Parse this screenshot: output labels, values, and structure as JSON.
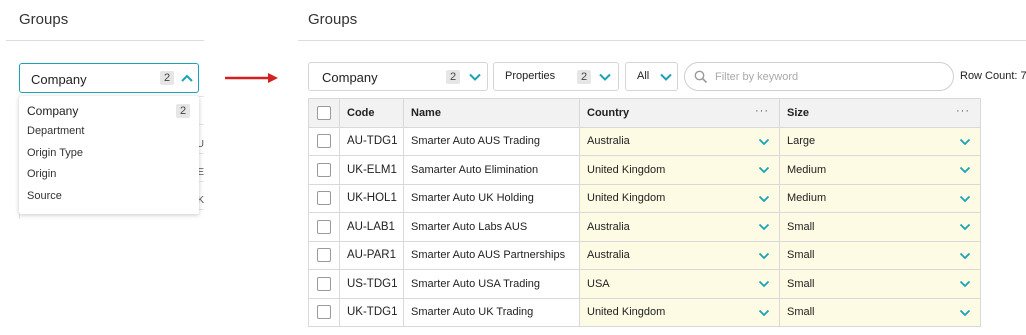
{
  "left": {
    "title": "Groups",
    "select": {
      "value": "Company",
      "count": "2"
    },
    "dropdown": {
      "items": [
        {
          "label": "Company",
          "count": "2"
        },
        {
          "label": "Department"
        },
        {
          "label": "Origin Type"
        },
        {
          "label": "Origin"
        },
        {
          "label": "Source"
        }
      ]
    },
    "behind_chars": [
      "U",
      "E",
      "K"
    ]
  },
  "right": {
    "title": "Groups",
    "toolbar": {
      "group": {
        "value": "Company",
        "count": "2"
      },
      "properties": {
        "label": "Properties",
        "count": "2"
      },
      "filter": {
        "value": "All"
      },
      "search": {
        "placeholder": "Filter by keyword",
        "value": ""
      },
      "row_count": "Row Count: 7"
    },
    "table": {
      "columns": [
        "Code",
        "Name",
        "Country",
        "Size"
      ],
      "more_label": "···",
      "rows": [
        {
          "code": "AU-TDG1",
          "name": "Smarter Auto AUS Trading",
          "country": "Australia",
          "size": "Large"
        },
        {
          "code": "UK-ELM1",
          "name": "Samarter Auto Elimination",
          "country": "United Kingdom",
          "size": "Medium"
        },
        {
          "code": "UK-HOL1",
          "name": "Smarter Auto UK Holding",
          "country": "United Kingdom",
          "size": "Medium"
        },
        {
          "code": "AU-LAB1",
          "name": "Smarter Auto Labs AUS",
          "country": "Australia",
          "size": "Small"
        },
        {
          "code": "AU-PAR1",
          "name": "Smarter Auto AUS Partnerships",
          "country": "Australia",
          "size": "Small"
        },
        {
          "code": "US-TDG1",
          "name": "Smarter Auto USA Trading",
          "country": "USA",
          "size": "Small"
        },
        {
          "code": "UK-TDG1",
          "name": "Smarter Auto UK Trading",
          "country": "United Kingdom",
          "size": "Small"
        }
      ]
    }
  },
  "icons": {
    "chevron_down": "chevron-down-icon",
    "chevron_up": "chevron-up-icon",
    "search": "search-icon",
    "arrow": "arrow-right-icon",
    "more": "more-icon"
  },
  "colors": {
    "accent": "#1aa3b8",
    "arrow": "#d32020",
    "editable_cell": "#fdfbe3"
  }
}
